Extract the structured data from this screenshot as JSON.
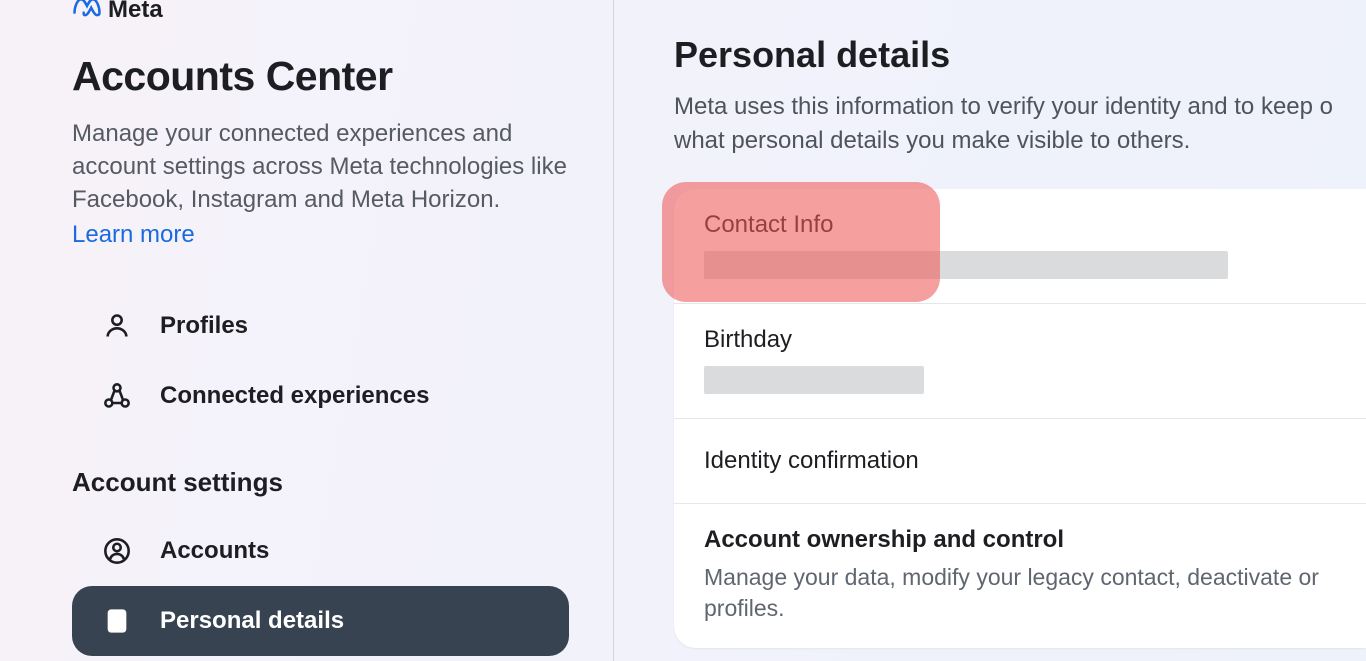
{
  "brand": {
    "name": "Meta"
  },
  "sidebar": {
    "title": "Accounts Center",
    "subtitle": "Manage your connected experiences and account settings across Meta technologies like Facebook, Instagram and Meta Horizon.",
    "learn_more": "Learn more",
    "nav_top": [
      {
        "label": "Profiles"
      },
      {
        "label": "Connected experiences"
      }
    ],
    "section_heading": "Account settings",
    "nav_settings": [
      {
        "label": "Accounts"
      },
      {
        "label": "Personal details",
        "active": true
      }
    ]
  },
  "main": {
    "title": "Personal details",
    "subtitle": "Meta uses this information to verify your identity and to keep o what personal details you make visible to others.",
    "rows": {
      "contact": {
        "title": "Contact Info"
      },
      "birthday": {
        "title": "Birthday"
      },
      "identity": {
        "title": "Identity confirmation"
      },
      "ownership": {
        "title": "Account ownership and control",
        "desc": "Manage your data, modify your legacy contact, deactivate or profiles."
      }
    }
  }
}
